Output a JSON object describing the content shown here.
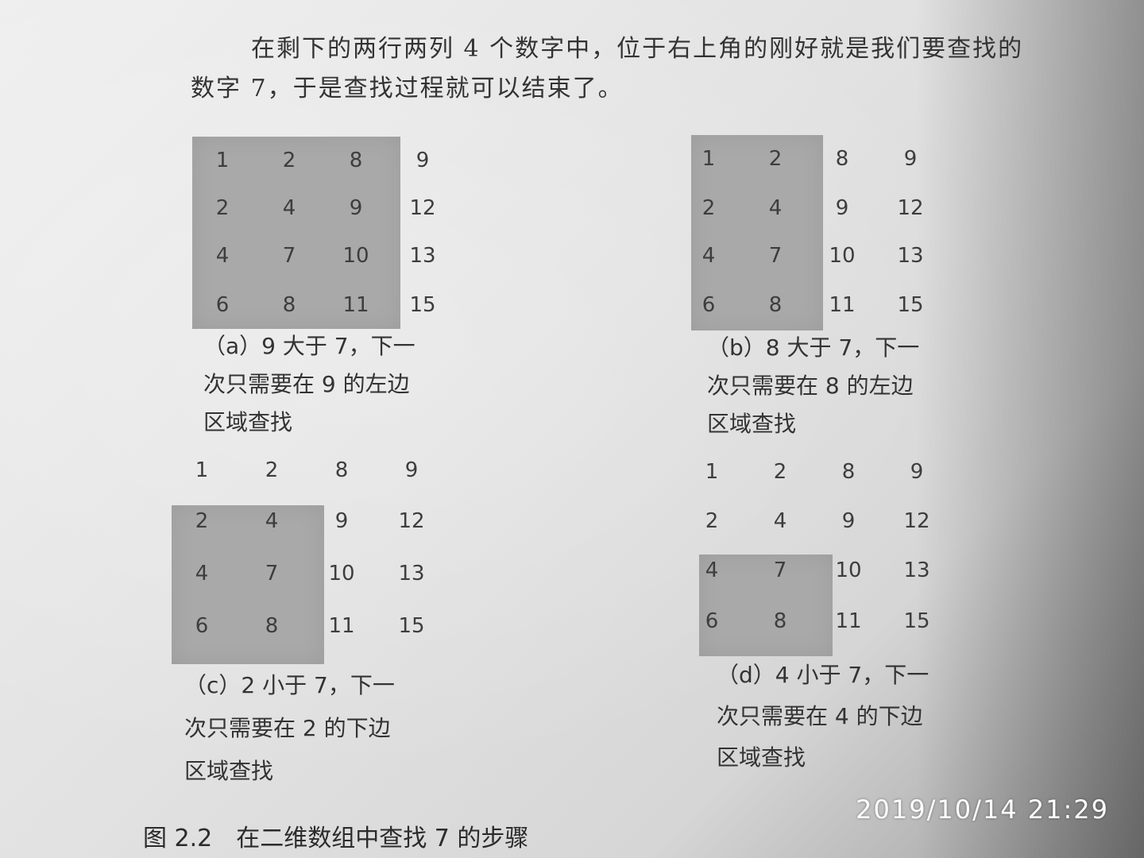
{
  "body_text": {
    "line1": "在剩下的两行两列 4 个数字中，位于右上角的刚好就是我们要查找的",
    "line2": "数字 7，于是查找过程就可以结束了。"
  },
  "figures": [
    {
      "id": "a",
      "matrix": [
        [
          "1",
          "2",
          "8",
          "9"
        ],
        [
          "2",
          "4",
          "9",
          "12"
        ],
        [
          "4",
          "7",
          "10",
          "13"
        ],
        [
          "6",
          "8",
          "11",
          "15"
        ]
      ],
      "caption": [
        "（a）9 大于 7，下一",
        "次只需要在 9 的左边",
        "区域查找"
      ]
    },
    {
      "id": "b",
      "matrix": [
        [
          "1",
          "2",
          "8",
          "9"
        ],
        [
          "2",
          "4",
          "9",
          "12"
        ],
        [
          "4",
          "7",
          "10",
          "13"
        ],
        [
          "6",
          "8",
          "11",
          "15"
        ]
      ],
      "caption": [
        "（b）8 大于 7，下一",
        "次只需要在 8 的左边",
        "区域查找"
      ]
    },
    {
      "id": "c",
      "matrix": [
        [
          "1",
          "2",
          "8",
          "9"
        ],
        [
          "2",
          "4",
          "9",
          "12"
        ],
        [
          "4",
          "7",
          "10",
          "13"
        ],
        [
          "6",
          "8",
          "11",
          "15"
        ]
      ],
      "caption": [
        "（c）2 小于 7，下一",
        "次只需要在 2 的下边",
        "区域查找"
      ]
    },
    {
      "id": "d",
      "matrix": [
        [
          "1",
          "2",
          "8",
          "9"
        ],
        [
          "2",
          "4",
          "9",
          "12"
        ],
        [
          "4",
          "7",
          "10",
          "13"
        ],
        [
          "6",
          "8",
          "11",
          "15"
        ]
      ],
      "caption": [
        "（d）4 小于 7，下一",
        "次只需要在 4 的下边",
        "区域查找"
      ]
    }
  ],
  "figure_title": "图 2.2　在二维数组中查找 7 的步骤",
  "timestamp": "2019/10/14  21:29"
}
